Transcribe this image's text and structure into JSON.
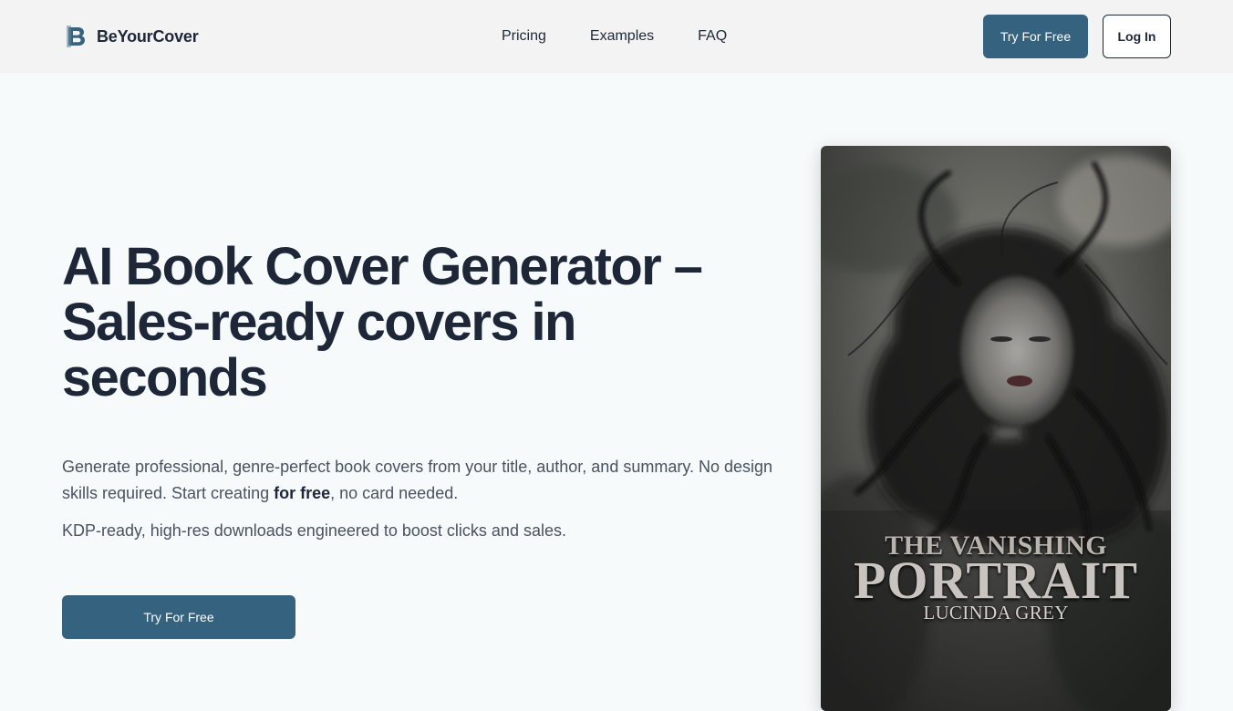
{
  "brand": {
    "name": "BeYourCover",
    "logo_icon": "b-letter-icon",
    "accent": "#35627f"
  },
  "nav": {
    "items": [
      "Pricing",
      "Examples",
      "FAQ"
    ]
  },
  "header_actions": {
    "try_label": "Try For Free",
    "login_label": "Log In"
  },
  "hero": {
    "title": "AI Book Cover Generator – Sales-ready covers in seconds",
    "desc_before": "Generate professional, genre-perfect book covers from your title, author, and summary. No design skills required. Start creating ",
    "desc_bold": "for free",
    "desc_after": ", no card needed.",
    "subtext": "KDP-ready, high-res downloads engineered to boost clicks and sales.",
    "cta_label": "Try For Free"
  },
  "cover": {
    "title_line1": "THE VANISHING",
    "title_line2": "PORTRAIT",
    "author": "LUCINDA GREY"
  }
}
